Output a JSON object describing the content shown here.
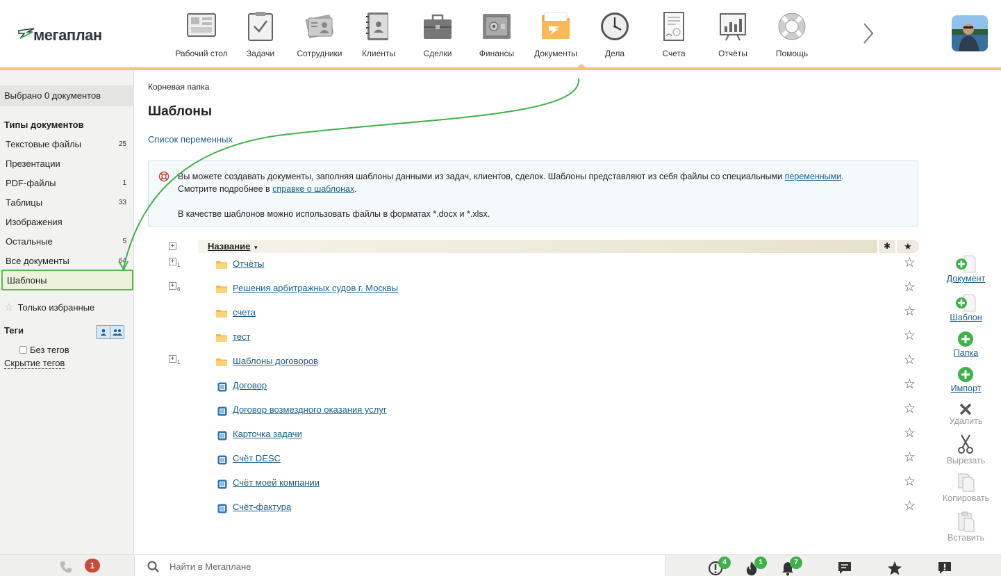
{
  "app": {
    "logo_text": "мегаплан"
  },
  "nav": {
    "items": [
      {
        "label": "Рабочий стол",
        "icon": "desktop-icon"
      },
      {
        "label": "Задачи",
        "icon": "tasks-icon"
      },
      {
        "label": "Сотрудники",
        "icon": "employees-icon"
      },
      {
        "label": "Клиенты",
        "icon": "clients-icon"
      },
      {
        "label": "Сделки",
        "icon": "deals-icon"
      },
      {
        "label": "Финансы",
        "icon": "finance-icon"
      },
      {
        "label": "Документы",
        "icon": "documents-icon",
        "active": true
      },
      {
        "label": "Дела",
        "icon": "clock-icon"
      },
      {
        "label": "Счета",
        "icon": "invoice-icon"
      },
      {
        "label": "Отчёты",
        "icon": "reports-icon"
      },
      {
        "label": "Помощь",
        "icon": "lifebuoy-icon"
      }
    ]
  },
  "sidebar": {
    "selected_count": "Выбрано 0 документов",
    "types_title": "Типы документов",
    "types": [
      {
        "label": "Текстовые файлы",
        "count": "25"
      },
      {
        "label": "Презентации",
        "count": ""
      },
      {
        "label": "PDF-файлы",
        "count": "1"
      },
      {
        "label": "Таблицы",
        "count": "33"
      },
      {
        "label": "Изображения",
        "count": ""
      },
      {
        "label": "Остальные",
        "count": "5"
      },
      {
        "label": "Все документы",
        "count": "64"
      },
      {
        "label": "Шаблоны",
        "count": "",
        "selected": true
      }
    ],
    "favorites_only": "Только избранные",
    "tags_title": "Теги",
    "no_tags": "Без тегов",
    "hide_tags": "Скрытие тегов"
  },
  "main": {
    "breadcrumb": "Корневая папка",
    "title": "Шаблоны",
    "variables_link": "Список переменных",
    "info": {
      "line1_a": "Вы можете создавать документы, заполняя шаблоны данными из задач, клиентов, сделок. Шаблоны представляют из себя файлы со специальными ",
      "line1_link": "переменными",
      "line1_b": ".",
      "line2_a": "Смотрите подробнее в ",
      "line2_link": "справке о шаблонах",
      "line2_b": ".",
      "line3": "В качестве шаблонов можно использовать файлы в форматах *.docx и *.xlsx."
    },
    "table": {
      "header_name": "Название",
      "rows": [
        {
          "type": "folder",
          "name": "Отчёты",
          "expandable": true,
          "sub": "1"
        },
        {
          "type": "folder",
          "name": "Решения арбитражных судов г. Москвы",
          "expandable": true,
          "sub": "6"
        },
        {
          "type": "folder",
          "name": "счета",
          "expandable": false,
          "sub": ""
        },
        {
          "type": "folder",
          "name": "тест",
          "expandable": false,
          "sub": ""
        },
        {
          "type": "folder",
          "name": "Шаблоны договоров",
          "expandable": true,
          "sub": "1"
        },
        {
          "type": "doc",
          "name": "Договор",
          "expandable": false,
          "sub": ""
        },
        {
          "type": "doc",
          "name": "Договор возмездного оказания услуг",
          "expandable": false,
          "sub": ""
        },
        {
          "type": "doc",
          "name": "Карточка задачи",
          "expandable": false,
          "sub": ""
        },
        {
          "type": "doc",
          "name": "Счёт DESC",
          "expandable": false,
          "sub": ""
        },
        {
          "type": "doc",
          "name": "Счёт моей компании",
          "expandable": false,
          "sub": ""
        },
        {
          "type": "doc",
          "name": "Счёт-фактура",
          "expandable": false,
          "sub": ""
        }
      ]
    }
  },
  "actions": {
    "document": "Документ",
    "template": "Шаблон",
    "folder": "Папка",
    "import": "Импорт",
    "delete": "Удалить",
    "cut": "Вырезать",
    "copy": "Копировать",
    "paste": "Вставить"
  },
  "footer": {
    "missed_calls": "1",
    "search_placeholder": "Найти в Мегаплане",
    "alerts_count": "4",
    "hot_count": "1",
    "notifications_count": "7"
  },
  "colors": {
    "accent": "#f6c27a",
    "link": "#1b5d8c",
    "green": "#3eb14a",
    "selected_border": "#59b84d"
  }
}
